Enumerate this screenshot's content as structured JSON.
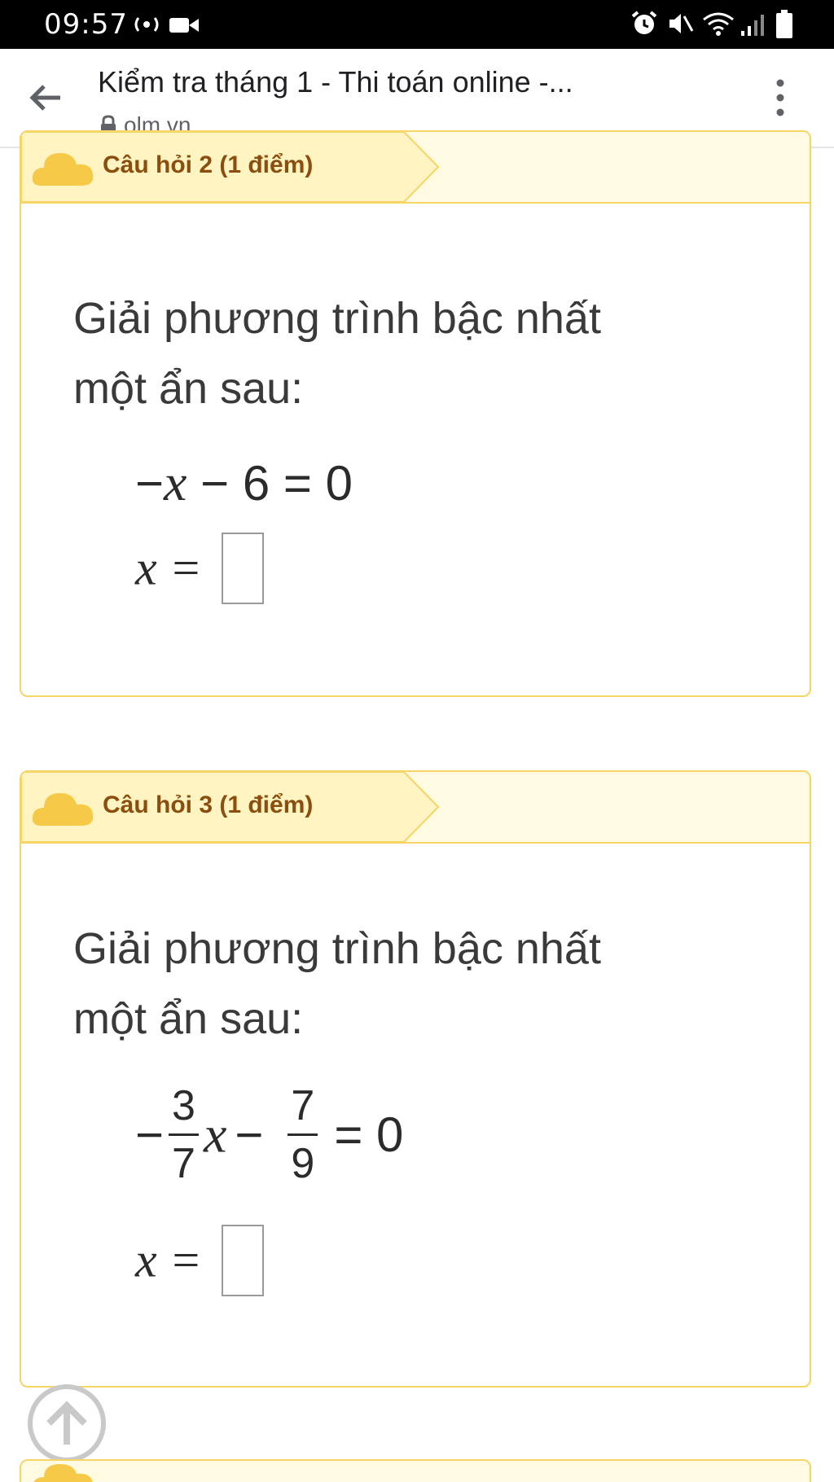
{
  "status_bar": {
    "time": "09:57"
  },
  "browser": {
    "page_title": "Kiểm tra tháng 1 - Thi toán online -...",
    "url": "olm.vn"
  },
  "questions": [
    {
      "title": "Câu hỏi 2 (1 điểm)",
      "prompt_line1": "Giải phương trình bậc nhất",
      "prompt_line2": "một ẩn sau:",
      "equation": {
        "minus": "−",
        "var": "x",
        "rest": " − 6 = 0"
      },
      "answer_lhs": "x ="
    },
    {
      "title": "Câu hỏi 3 (1 điểm)",
      "prompt_line1": "Giải phương trình bậc nhất",
      "prompt_line2": "một ẩn sau:",
      "equation": {
        "minus1": "−",
        "frac1_num": "3",
        "frac1_den": "7",
        "var": "x",
        "minus2": "−",
        "frac2_num": "7",
        "frac2_den": "9",
        "rest": "= 0"
      },
      "answer_lhs": "x ="
    }
  ],
  "colors": {
    "card_border": "#f6d466",
    "card_header_bg": "#fffbe3",
    "card_title": "#8a4f0e",
    "cloud": "#f7c948"
  },
  "icons": [
    "back-arrow-icon",
    "lock-icon",
    "more-vert-icon",
    "cloud-icon",
    "arrow-up-icon",
    "alarm-icon",
    "mute-icon",
    "wifi-icon",
    "signal-icon",
    "battery-icon",
    "video-icon",
    "hotspot-icon"
  ]
}
